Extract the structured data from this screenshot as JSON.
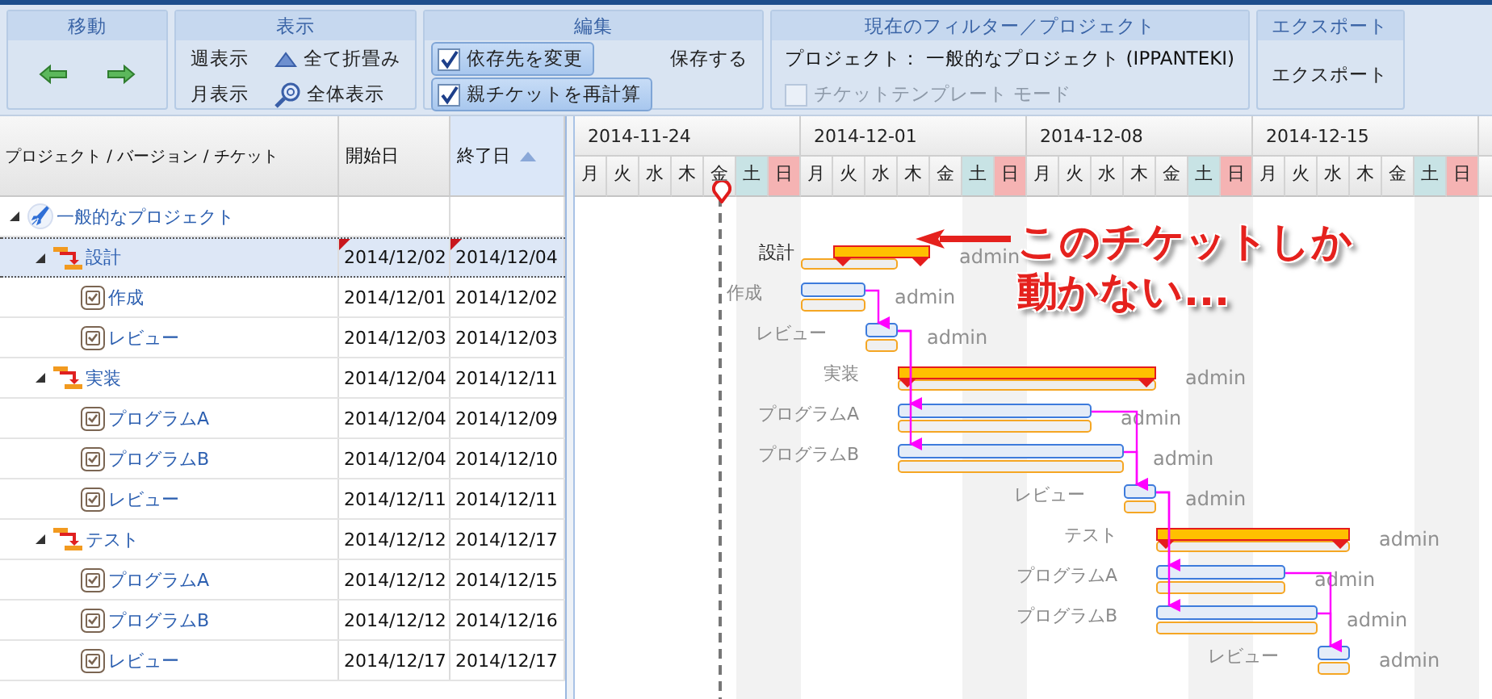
{
  "toolbar": {
    "groups": [
      {
        "title": "移動",
        "items": [
          {
            "kind": "back"
          },
          {
            "kind": "forward"
          }
        ]
      },
      {
        "title": "表示",
        "items": [
          {
            "kind": "text",
            "label": "週表示"
          },
          {
            "kind": "collapse",
            "label": "全て折畳み"
          },
          {
            "kind": "text",
            "label": "月表示"
          },
          {
            "kind": "zoom",
            "label": "全体表示"
          }
        ]
      },
      {
        "title": "編集",
        "items": [
          {
            "kind": "toggle",
            "label": "依存先を変更",
            "checked": true,
            "disabled": false
          },
          {
            "kind": "text",
            "label": "保存する"
          },
          {
            "kind": "toggle",
            "label": "親チケットを再計算",
            "checked": true,
            "disabled": false
          }
        ]
      },
      {
        "title": "現在のフィルター／プロジェクト",
        "items": [
          {
            "kind": "info",
            "label": "プロジェクト： 一般的なプロジェクト (IPPANTEKI)"
          },
          {
            "kind": "toggle",
            "label": "チケットテンプレート モード",
            "checked": false,
            "disabled": true
          }
        ]
      },
      {
        "title": "エクスポート",
        "items": [
          {
            "kind": "text",
            "label": "エクスポート"
          }
        ]
      }
    ]
  },
  "grid": {
    "columns": [
      {
        "label": "プロジェクト / バージョン / チケット",
        "sorted": false
      },
      {
        "label": "開始日",
        "sorted": false
      },
      {
        "label": "終了日",
        "sorted": true
      }
    ],
    "rows": [
      {
        "kind": "project",
        "name": "一般的なプロジェクト",
        "expanded": true,
        "selected": false,
        "modified": false,
        "children": [
          {
            "kind": "version",
            "name": "設計",
            "start": "2014/12/02",
            "end": "2014/12/04",
            "expanded": true,
            "selected": true,
            "modified": true,
            "children": [
              {
                "kind": "ticket",
                "name": "作成",
                "start": "2014/12/01",
                "end": "2014/12/02",
                "selected": false,
                "modified": false
              },
              {
                "kind": "ticket",
                "name": "レビュー",
                "start": "2014/12/03",
                "end": "2014/12/03",
                "selected": false,
                "modified": false
              }
            ]
          },
          {
            "kind": "version",
            "name": "実装",
            "start": "2014/12/04",
            "end": "2014/12/11",
            "expanded": true,
            "selected": false,
            "modified": false,
            "children": [
              {
                "kind": "ticket",
                "name": "プログラムA",
                "start": "2014/12/04",
                "end": "2014/12/09",
                "selected": false,
                "modified": false
              },
              {
                "kind": "ticket",
                "name": "プログラムB",
                "start": "2014/12/04",
                "end": "2014/12/10",
                "selected": false,
                "modified": false
              },
              {
                "kind": "ticket",
                "name": "レビュー",
                "start": "2014/12/11",
                "end": "2014/12/11",
                "selected": false,
                "modified": false
              }
            ]
          },
          {
            "kind": "version",
            "name": "テスト",
            "start": "2014/12/12",
            "end": "2014/12/17",
            "expanded": true,
            "selected": false,
            "modified": false,
            "children": [
              {
                "kind": "ticket",
                "name": "プログラムA",
                "start": "2014/12/12",
                "end": "2014/12/15",
                "selected": false,
                "modified": false
              },
              {
                "kind": "ticket",
                "name": "プログラムB",
                "start": "2014/12/12",
                "end": "2014/12/16",
                "selected": false,
                "modified": false
              },
              {
                "kind": "ticket",
                "name": "レビュー",
                "start": "2014/12/17",
                "end": "2014/12/17",
                "selected": false,
                "modified": false
              }
            ]
          }
        ]
      }
    ]
  },
  "gantt": {
    "weeks": [
      {
        "label": "2014-11-24",
        "days": [
          {
            "label": "月",
            "kind": "weekday"
          },
          {
            "label": "火",
            "kind": "weekday"
          },
          {
            "label": "水",
            "kind": "weekday"
          },
          {
            "label": "木",
            "kind": "weekday"
          },
          {
            "label": "金",
            "kind": "weekday"
          },
          {
            "label": "土",
            "kind": "saturday"
          },
          {
            "label": "日",
            "kind": "sunday"
          }
        ]
      },
      {
        "label": "2014-12-01",
        "days": [
          {
            "label": "月",
            "kind": "weekday"
          },
          {
            "label": "火",
            "kind": "weekday"
          },
          {
            "label": "水",
            "kind": "weekday"
          },
          {
            "label": "木",
            "kind": "weekday"
          },
          {
            "label": "金",
            "kind": "weekday"
          },
          {
            "label": "土",
            "kind": "saturday"
          },
          {
            "label": "日",
            "kind": "sunday"
          }
        ]
      },
      {
        "label": "2014-12-08",
        "days": [
          {
            "label": "月",
            "kind": "weekday"
          },
          {
            "label": "火",
            "kind": "weekday"
          },
          {
            "label": "水",
            "kind": "weekday"
          },
          {
            "label": "木",
            "kind": "weekday"
          },
          {
            "label": "金",
            "kind": "weekday"
          },
          {
            "label": "土",
            "kind": "saturday"
          },
          {
            "label": "日",
            "kind": "sunday"
          }
        ]
      },
      {
        "label": "2014-12-15",
        "days": [
          {
            "label": "月",
            "kind": "weekday"
          },
          {
            "label": "火",
            "kind": "weekday"
          },
          {
            "label": "水",
            "kind": "weekday"
          },
          {
            "label": "木",
            "kind": "weekday"
          },
          {
            "label": "金",
            "kind": "weekday"
          },
          {
            "label": "土",
            "kind": "saturday"
          },
          {
            "label": "日",
            "kind": "sunday"
          }
        ]
      }
    ],
    "tasks": [
      {
        "kind": "project"
      },
      {
        "kind": "version",
        "name": "設計",
        "assignee": "admin",
        "selected": true
      },
      {
        "kind": "ticket",
        "name": "作成",
        "assignee": "admin",
        "selected": false
      },
      {
        "kind": "ticket",
        "name": "レビュー",
        "assignee": "admin",
        "selected": false
      },
      {
        "kind": "version",
        "name": "実装",
        "assignee": "admin",
        "selected": false
      },
      {
        "kind": "ticket",
        "name": "プログラムA",
        "assignee": "admin",
        "selected": false
      },
      {
        "kind": "ticket",
        "name": "プログラムB",
        "assignee": "admin",
        "selected": false
      },
      {
        "kind": "ticket",
        "name": "レビュー",
        "assignee": "admin",
        "selected": false
      },
      {
        "kind": "version",
        "name": "テスト",
        "assignee": "admin",
        "selected": false
      },
      {
        "kind": "ticket",
        "name": "プログラムA",
        "assignee": "admin",
        "selected": false
      },
      {
        "kind": "ticket",
        "name": "プログラムB",
        "assignee": "admin",
        "selected": false
      },
      {
        "kind": "ticket",
        "name": "レビュー",
        "assignee": "admin",
        "selected": false
      }
    ],
    "annotation": {
      "lines": [
        "このチケットしか",
        "動かない..."
      ]
    }
  }
}
